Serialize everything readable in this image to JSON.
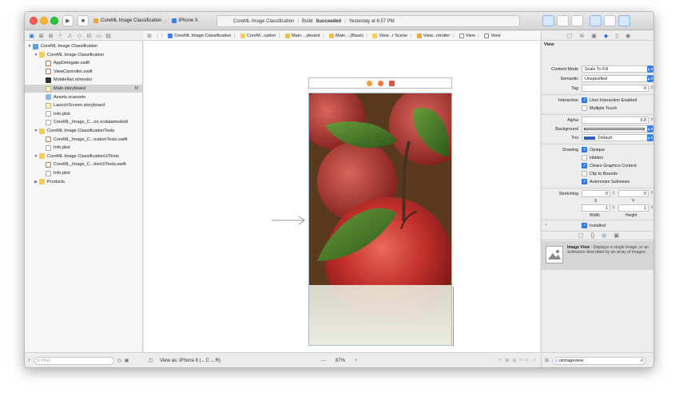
{
  "toolbar": {
    "scheme_name": "CoreML Image Classification",
    "device_name": "iPhone X",
    "status_project": "CoreML Image Classification",
    "status_build_prefix": "Build",
    "status_build_result": "Succeeded",
    "status_time": "Yesterday at 6:57 PM"
  },
  "navigator": {
    "items": [
      {
        "label": "CoreML Image Classification",
        "level": 0,
        "icon": "project-icon",
        "disclosure": "▼"
      },
      {
        "label": "CoreML Image Classification",
        "level": 1,
        "icon": "folder-icon",
        "disclosure": "▼"
      },
      {
        "label": "AppDelegate.swift",
        "level": 2,
        "icon": "swift-file-icon",
        "disclosure": ""
      },
      {
        "label": "ViewController.swift",
        "level": 2,
        "icon": "swift-file-icon",
        "disclosure": ""
      },
      {
        "label": "MobileNet.mlmodel",
        "level": 2,
        "icon": "mlmodel-icon",
        "disclosure": ""
      },
      {
        "label": "Main.storyboard",
        "level": 2,
        "icon": "storyboard-icon",
        "disclosure": "",
        "badge": "M",
        "selected": true
      },
      {
        "label": "Assets.xcassets",
        "level": 2,
        "icon": "assets-icon",
        "disclosure": ""
      },
      {
        "label": "LaunchScreen.storyboard",
        "level": 2,
        "icon": "storyboard-icon",
        "disclosure": ""
      },
      {
        "label": "Info.plist",
        "level": 2,
        "icon": "plist-icon",
        "disclosure": ""
      },
      {
        "label": "CoreML_Image_C...on.xcdatamodeld",
        "level": 2,
        "icon": "datamodel-icon",
        "disclosure": ""
      },
      {
        "label": "CoreML Image ClassificationTests",
        "level": 1,
        "icon": "folder-icon",
        "disclosure": "▼"
      },
      {
        "label": "CoreML_Image_C...icationTests.swift",
        "level": 2,
        "icon": "swift-file-icon",
        "disclosure": ""
      },
      {
        "label": "Info.plist",
        "level": 2,
        "icon": "plist-icon",
        "disclosure": ""
      },
      {
        "label": "CoreML Image ClassificationUITests",
        "level": 1,
        "icon": "folder-icon",
        "disclosure": "▼"
      },
      {
        "label": "CoreML_Image_C...tionUITests.swift",
        "level": 2,
        "icon": "swift-file-icon",
        "disclosure": ""
      },
      {
        "label": "Info.plist",
        "level": 2,
        "icon": "plist-icon",
        "disclosure": ""
      },
      {
        "label": "Products",
        "level": 1,
        "icon": "folder-icon",
        "disclosure": "▶"
      }
    ],
    "filter_placeholder": "Filter"
  },
  "jumpbar": {
    "crumbs": [
      {
        "label": "CoreML Image Classification",
        "icon": "project-icon"
      },
      {
        "label": "CoreM...cation",
        "icon": "folder-icon"
      },
      {
        "label": "Main....yboard",
        "icon": "storyboard-icon"
      },
      {
        "label": "Main....(Base)",
        "icon": "storyboard-icon"
      },
      {
        "label": "View...r Scene",
        "icon": "scene-icon"
      },
      {
        "label": "View...ntroller",
        "icon": "view-controller-icon"
      },
      {
        "label": "View",
        "icon": "view-icon"
      },
      {
        "label": "View",
        "icon": "view-icon"
      }
    ]
  },
  "canvas": {
    "view_as": "View as: iPhone 8 (←C ←R)",
    "zoom_minus": "—",
    "zoom_level": "87%",
    "zoom_plus": "+"
  },
  "inspector": {
    "section_title": "View",
    "content_mode_label": "Content Mode",
    "content_mode_value": "Scale To Fill",
    "semantic_label": "Semantic",
    "semantic_value": "Unspecified",
    "tag_label": "Tag",
    "tag_value": "0",
    "interaction_label": "Interaction",
    "user_interaction_label": "User Interaction Enabled",
    "multiple_touch_label": "Multiple Touch",
    "alpha_label": "Alpha",
    "alpha_value": "0.8",
    "background_label": "Background",
    "tint_label": "Tint",
    "tint_value": "Default",
    "drawing_label": "Drawing",
    "opaque_label": "Opaque",
    "hidden_label": "Hidden",
    "clears_label": "Clears Graphics Context",
    "clip_label": "Clip to Bounds",
    "autoresize_label": "Autoresize Subviews",
    "stretching_label": "Stretching",
    "stretch_x": "0",
    "stretch_y": "0",
    "x_label": "X",
    "y_label": "Y",
    "stretch_w": "1",
    "stretch_h": "1",
    "width_label": "Width",
    "height_label": "Height",
    "installed_label": "Installed",
    "plus_sign": "+"
  },
  "library": {
    "item_title": "Image View",
    "item_desc": " - Displays a single image, or an animation described by an array of images.",
    "filter_value": "uiimageview"
  },
  "colors": {
    "accent": "#3b82e6",
    "tint_swatch": "#2b5fbf"
  }
}
